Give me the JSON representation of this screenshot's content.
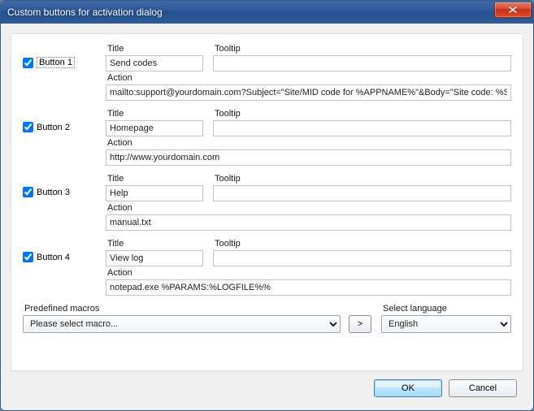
{
  "window": {
    "title": "Custom buttons for activation dialog"
  },
  "labels": {
    "title": "Title",
    "tooltip": "Tooltip",
    "action": "Action",
    "predefined_macros": "Predefined macros",
    "select_language": "Select language"
  },
  "buttons": [
    {
      "checked": true,
      "name": "Button 1",
      "title": "Send codes",
      "tooltip": "",
      "action": "mailto:support@yourdomain.com?Subject=\"Site/MID code for %APPNAME%\"&Body=\"Site code: %S"
    },
    {
      "checked": true,
      "name": "Button 2",
      "title": "Homepage",
      "tooltip": "",
      "action": "http://www.yourdomain.com"
    },
    {
      "checked": true,
      "name": "Button 3",
      "title": "Help",
      "tooltip": "",
      "action": "manual.txt"
    },
    {
      "checked": true,
      "name": "Button 4",
      "title": "View log",
      "tooltip": "",
      "action": "notepad.exe %PARAMS:%LOGFILE%%"
    }
  ],
  "macro_select": {
    "placeholder": "Please select macro...",
    "go_label": ">"
  },
  "language_select": {
    "value": "English"
  },
  "footer": {
    "ok": "OK",
    "cancel": "Cancel"
  }
}
